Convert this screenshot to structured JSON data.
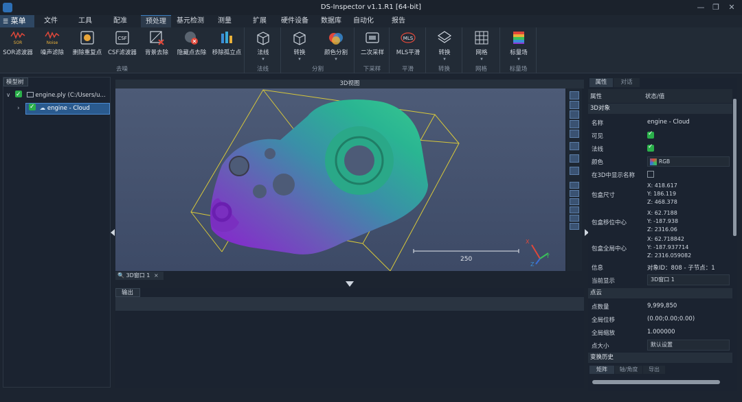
{
  "window": {
    "title": "DS-Inspector v1.1.R1 [64-bit]"
  },
  "menu": {
    "main": "菜单",
    "items": [
      "文件",
      "工具",
      "配准",
      "预处理",
      "基元检测",
      "测量",
      "扩展",
      "硬件设备",
      "数据库",
      "自动化",
      "报告"
    ],
    "active": "预处理"
  },
  "ribbon": {
    "groups": [
      {
        "label": "去噪",
        "tools": [
          "SOR滤波器",
          "噪声滤除",
          "删除重复点",
          "CSF滤波器",
          "背景去除",
          "隐藏点去除",
          "移除孤立点"
        ],
        "badges": {
          "sor": "SOR",
          "noise": "Noise",
          "csf": "CSF"
        }
      },
      {
        "label": "法线",
        "tools": [
          "法线"
        ]
      },
      {
        "label": "分割",
        "tools": [
          "转换",
          "颜色分割"
        ]
      },
      {
        "label": "下采样",
        "tools": [
          "二次采样"
        ]
      },
      {
        "label": "平滑",
        "tools": [
          "MLS平滑"
        ],
        "badges": {
          "mls": "MLS"
        }
      },
      {
        "label": "转换",
        "tools": [
          "转换"
        ]
      },
      {
        "label": "网格",
        "tools": [
          "网格"
        ]
      },
      {
        "label": "标量场",
        "tools": [
          "标量场"
        ]
      }
    ]
  },
  "model_tree": {
    "tab": "模型树",
    "file": "engine.ply (C:/Users/u...",
    "cloud": "engine - Cloud"
  },
  "view3d": {
    "title": "3D视图",
    "tab": "3D窗口 1",
    "scale_label": "250",
    "axes": {
      "x": "X",
      "y": "Y",
      "z": "Z"
    }
  },
  "output": {
    "tab": "输出"
  },
  "properties": {
    "tabs": [
      "属性",
      "对话"
    ],
    "col_key": "属性",
    "col_val": "状态/值",
    "section_object": "3D对象",
    "name_k": "名称",
    "name_v": "engine - Cloud",
    "visible_k": "可见",
    "normals_k": "法线",
    "color_k": "颜色",
    "color_v": "RGB",
    "showname_k": "在3D中显示名称",
    "bbox_size_k": "包盒尺寸",
    "bbox_size": [
      "X: 418.617",
      "Y: 186.119",
      "Z: 468.378"
    ],
    "bbox_local_k": "包盒移位中心",
    "bbox_local": [
      "X: 62.7188",
      "Y: -187.938",
      "Z: 2316.06"
    ],
    "bbox_global_k": "包盒全局中心",
    "bbox_global": [
      "X: 62.718842",
      "Y: -187.937714",
      "Z: 2316.059082"
    ],
    "info_k": "信息",
    "info_v": "对象ID：808 - 子节点：1",
    "display_k": "当前显示",
    "display_v": "3D窗口 1",
    "section_cloud": "点云",
    "points_k": "点数量",
    "points_v": "9,999,850",
    "shift_k": "全局位移",
    "shift_v": "(0.00;0.00;0.00)",
    "scale_k": "全局缩放",
    "scale_v": "1.000000",
    "ptsize_k": "点大小",
    "ptsize_v": "默认设置",
    "section_history": "变换历史",
    "history_tabs": [
      "矩阵",
      "轴/角度",
      "导出"
    ]
  },
  "colors": {
    "accent": "#3a7fc2",
    "teal": "#2bb08a",
    "purple": "#7a2fc0",
    "bbox": "#d9c93a"
  }
}
